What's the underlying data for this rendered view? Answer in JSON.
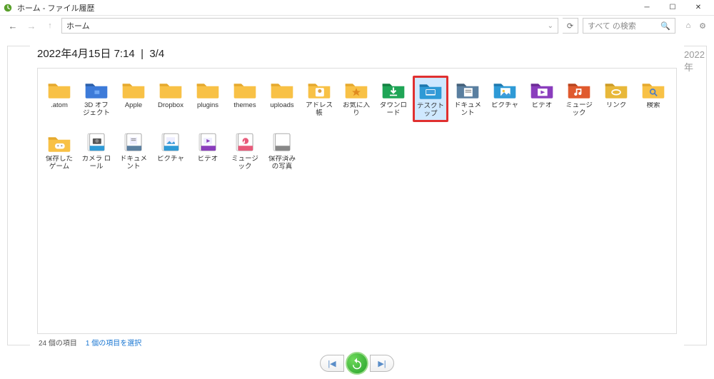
{
  "window": {
    "title": "ホーム - ファイル履歴"
  },
  "nav": {
    "address": "ホーム",
    "search_placeholder": "すべて の検索"
  },
  "snapshot": {
    "timestamp": "2022年4月15日 7:14",
    "page": "3/4"
  },
  "next_hint": "2022年",
  "items": [
    {
      "label": ".atom",
      "icon": "folder",
      "selected": false
    },
    {
      "label": "3D オブジェクト",
      "icon": "folder-3d",
      "selected": false
    },
    {
      "label": "Apple",
      "icon": "folder",
      "selected": false
    },
    {
      "label": "Dropbox",
      "icon": "folder",
      "selected": false
    },
    {
      "label": "plugins",
      "icon": "folder",
      "selected": false
    },
    {
      "label": "themes",
      "icon": "folder",
      "selected": false
    },
    {
      "label": "uploads",
      "icon": "folder",
      "selected": false
    },
    {
      "label": "アドレス帳",
      "icon": "folder-contacts",
      "selected": false
    },
    {
      "label": "お気に入り",
      "icon": "folder-star",
      "selected": false
    },
    {
      "label": "ダウンロード",
      "icon": "folder-download",
      "selected": false
    },
    {
      "label": "デスクトップ",
      "icon": "folder-desktop",
      "selected": true
    },
    {
      "label": "ドキュメント",
      "icon": "folder-docs-lib",
      "selected": false
    },
    {
      "label": "ピクチャ",
      "icon": "folder-pics-lib",
      "selected": false
    },
    {
      "label": "ビデオ",
      "icon": "folder-video-lib",
      "selected": false
    },
    {
      "label": "ミュージック",
      "icon": "folder-music-lib",
      "selected": false
    },
    {
      "label": "リンク",
      "icon": "folder-link",
      "selected": false
    },
    {
      "label": "検索",
      "icon": "folder-search",
      "selected": false
    },
    {
      "label": "保存したゲーム",
      "icon": "folder-games",
      "selected": false
    },
    {
      "label": "カメラ ロール",
      "icon": "lib-camera",
      "selected": false
    },
    {
      "label": "ドキュメント",
      "icon": "lib-docs",
      "selected": false
    },
    {
      "label": "ピクチャ",
      "icon": "lib-pics",
      "selected": false
    },
    {
      "label": "ビデオ",
      "icon": "lib-video",
      "selected": false
    },
    {
      "label": "ミュージック",
      "icon": "lib-music",
      "selected": false
    },
    {
      "label": "保存済みの写真",
      "icon": "lib-saved",
      "selected": false
    }
  ],
  "status": {
    "count": "24 個の項目",
    "selection": "1 個の項目を選択"
  }
}
